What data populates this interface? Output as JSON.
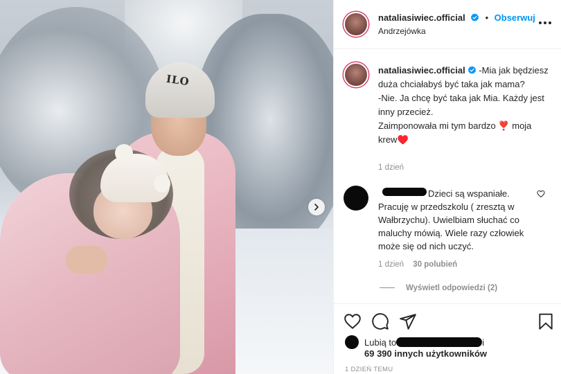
{
  "post": {
    "next_label": "Next"
  },
  "header": {
    "username": "nataliasiwiec.official",
    "separator": "•",
    "follow_label": "Obserwuj",
    "location": "Andrzejówka"
  },
  "caption": {
    "username": "nataliasiwiec.official",
    "line1": "-Mia jak będziesz duża chciałabyś być taka jak mama?",
    "line2": "-Nie. Ja chcę być taka jak Mia. Każdy jest inny przecież.",
    "line3_start": "Zaimponowała mi tym bardzo",
    "line3_emoji": "❣️",
    "line3_end": "moja krew♥️",
    "time": "1 dzień"
  },
  "comment": {
    "text": "Dzieci są wspaniałe. Pracuję w przedszkolu ( zresztą w Wałbrzychu). Uwielbiam słuchać co maluchy mówią. Wiele razy człowiek może się od nich uczyć.",
    "time": "1 dzień",
    "likes": "30 polubień",
    "view_replies": "Wyświetl odpowiedzi (2)"
  },
  "likes": {
    "prefix": "Lubią to",
    "suffix": "i",
    "count": "69 390 innych użytkowników"
  },
  "timestamp": "1 DZIEŃ TEMU",
  "photo": {
    "hat_text": "ILO"
  },
  "colors": {
    "accent_blue": "#0095f6",
    "text": "#262626",
    "muted": "#8e8e8e",
    "story_ring": "#d73a6a"
  },
  "icons": {
    "verified": "verified-badge-icon",
    "like": "heart-icon",
    "comment": "comment-bubble-icon",
    "share": "paper-plane-icon",
    "save": "bookmark-icon",
    "more": "more-options-icon",
    "next": "chevron-right-icon"
  }
}
